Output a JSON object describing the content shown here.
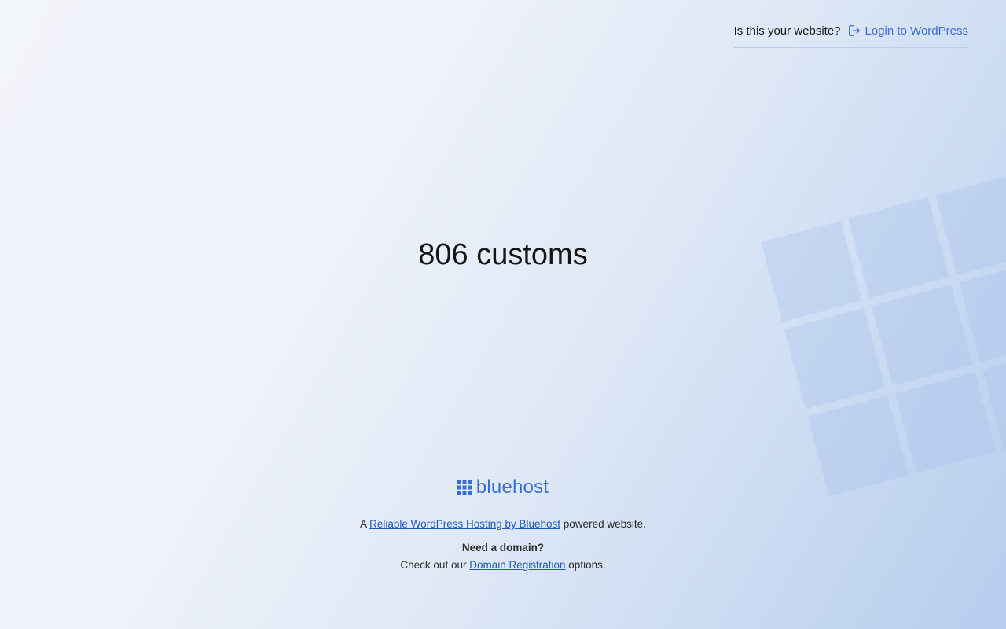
{
  "header": {
    "question": "Is this your website?",
    "login_label": "Login to WordPress",
    "login_icon": "login-icon"
  },
  "site": {
    "title": "806 customs"
  },
  "footer": {
    "brand_name": "bluehost",
    "brand_icon": "bluehost-grid-icon",
    "powered_prefix": "A",
    "powered_link": "Reliable WordPress Hosting by Bluehost",
    "powered_suffix": "powered website.",
    "domain_question": "Need a domain?",
    "domain_prefix": "Check out our",
    "domain_link": "Domain Registration",
    "domain_suffix": "options."
  },
  "colors": {
    "accent": "#3d6fd6",
    "link": "#2058b8",
    "divider": "#b9cdf0"
  }
}
